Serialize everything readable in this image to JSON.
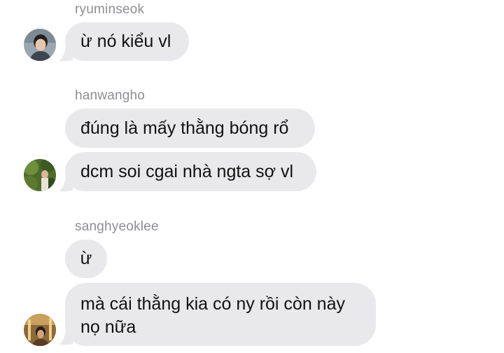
{
  "groups": [
    {
      "username": "ryuminseok",
      "messages": [
        "ừ nó kiểu vl"
      ]
    },
    {
      "username": "hanwangho",
      "messages": [
        "đúng là mấy thằng bóng rổ",
        "dcm soi cgai nhà ngta sợ vl"
      ]
    },
    {
      "username": "sanghyeoklee",
      "messages": [
        "ừ",
        "mà cái thằng kia có ny rồi còn này nọ nữa"
      ]
    }
  ],
  "colors": {
    "bubble": "#e9e9eb",
    "username": "#8e8e93",
    "text": "#111111"
  }
}
